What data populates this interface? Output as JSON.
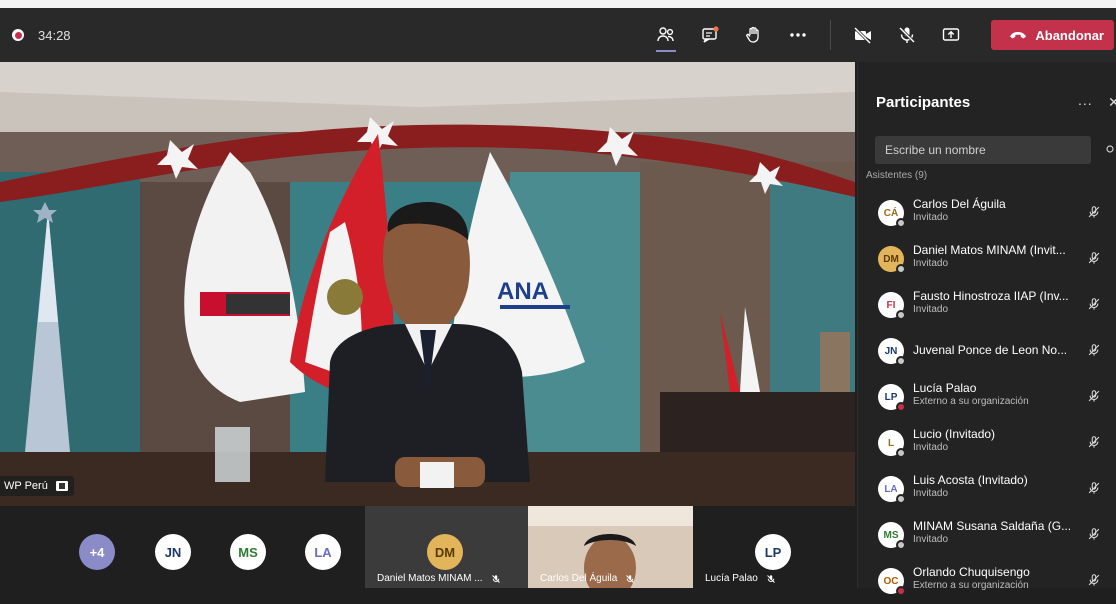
{
  "meeting": {
    "timer": "34:28",
    "leave_label": "Abandonar"
  },
  "toolbar_icons": [
    "participants-icon",
    "chat-icon",
    "raise-hand-icon",
    "more-icon",
    "camera-off-icon",
    "mic-off-icon",
    "share-icon"
  ],
  "stage": {
    "speaker_label": "WP Perú"
  },
  "gallery": {
    "overflow": "+4",
    "avatars": [
      "JN",
      "MS",
      "LA"
    ],
    "tiles": [
      {
        "initials": "DM",
        "label": "Daniel Matos MINAM ..."
      },
      {
        "initials": "",
        "label": "Carlos Del Águila"
      },
      {
        "initials": "LP",
        "label": "Lucía Palao"
      }
    ]
  },
  "panel": {
    "title": "Participantes",
    "more": "...",
    "close": "✕",
    "search_placeholder": "Escribe un nombre",
    "section": "Asistentes (9)",
    "participants": [
      {
        "initials": "CÁ",
        "name": "Carlos Del Águila",
        "role": "Invitado",
        "external": false
      },
      {
        "initials": "DM",
        "name": "Daniel Matos MINAM (Invit...",
        "role": "Invitado",
        "external": false
      },
      {
        "initials": "FI",
        "name": "Fausto Hinostroza IIAP (Inv...",
        "role": "Invitado",
        "external": false
      },
      {
        "initials": "JN",
        "name": "Juvenal Ponce de Leon No...",
        "role": "",
        "external": false
      },
      {
        "initials": "LP",
        "name": "Lucía Palao",
        "role": "Externo a su organización",
        "external": true
      },
      {
        "initials": "L",
        "name": "Lucio (Invitado)",
        "role": "Invitado",
        "external": false
      },
      {
        "initials": "LA",
        "name": "Luis Acosta (Invitado)",
        "role": "Invitado",
        "external": false
      },
      {
        "initials": "MS",
        "name": "MINAM Susana Saldaña (G...",
        "role": "Invitado",
        "external": false
      },
      {
        "initials": "OC",
        "name": "Orlando Chuquisengo",
        "role": "Externo a su organización",
        "external": true
      }
    ]
  },
  "colors": {
    "leave": "#c4314b",
    "avatar_purple_bg": "#8b8cc7",
    "avatar_gold": "#e3b55a"
  }
}
